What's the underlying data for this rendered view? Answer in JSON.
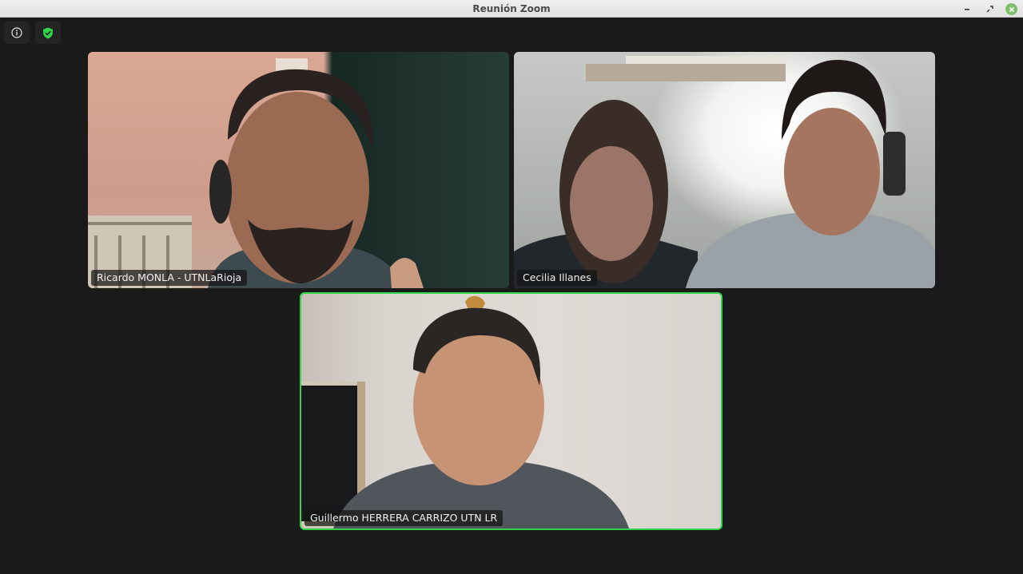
{
  "window": {
    "title": "Reunión Zoom"
  },
  "toolbar": {
    "info_icon": "info-icon",
    "security_icon": "shield-check-icon",
    "security_color": "#2fd44a"
  },
  "participants": [
    {
      "name": "Ricardo MONLA - UTNLaRioja",
      "active_speaker": false
    },
    {
      "name": "Cecilia Illanes",
      "active_speaker": false
    },
    {
      "name": "Guillermo HERRERA CARRIZO UTN LR",
      "active_speaker": true
    }
  ],
  "colors": {
    "background": "#1a1a1a",
    "active_speaker_border": "#2fd44a"
  }
}
